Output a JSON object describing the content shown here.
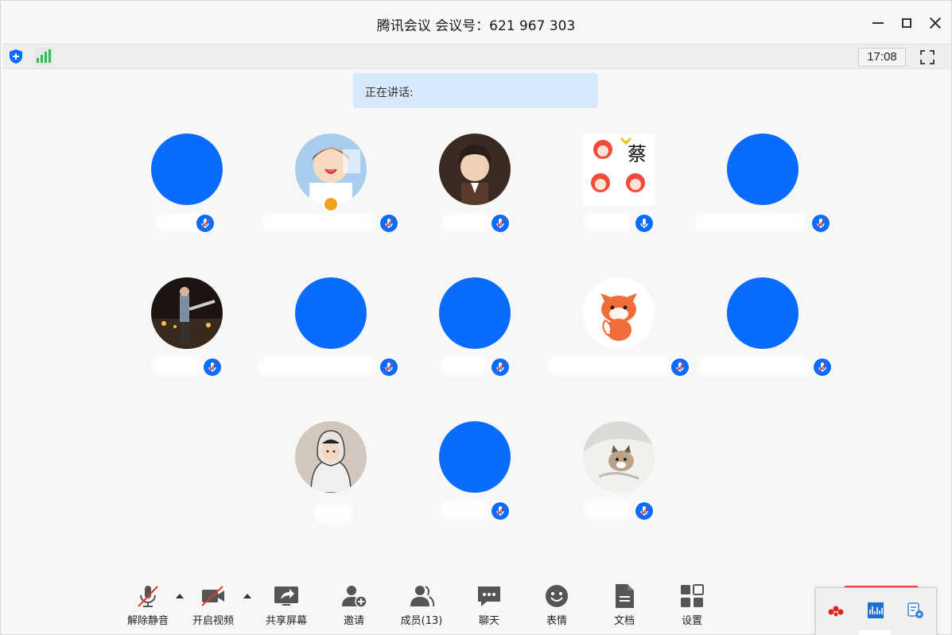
{
  "window": {
    "title": "腾讯会议 会议号：621 967 303",
    "controls": [
      "minimize",
      "maximize",
      "close"
    ]
  },
  "infobar": {
    "security_icon": "shield-icon",
    "signal_icon": "signal-strength-icon",
    "time": "17:08",
    "fullscreen_icon": "fullscreen-icon"
  },
  "speaking": {
    "label": "正在讲话:"
  },
  "participants": [
    {
      "avatar": "blue-circle",
      "mic": "muted"
    },
    {
      "avatar": "anime-girl",
      "mic": "muted",
      "host": true
    },
    {
      "avatar": "anime-boy",
      "mic": "muted"
    },
    {
      "avatar": "fox-sticker-cai",
      "mic": "unmuted",
      "avatar_text": "蔡"
    },
    {
      "avatar": "blue-circle",
      "mic": "muted"
    },
    {
      "avatar": "night-photo",
      "mic": "muted"
    },
    {
      "avatar": "blue-circle",
      "mic": "muted"
    },
    {
      "avatar": "blue-circle",
      "mic": "muted"
    },
    {
      "avatar": "fox-cartoon",
      "mic": "muted"
    },
    {
      "avatar": "blue-circle",
      "mic": "muted"
    },
    {
      "avatar": "hoodie-boy",
      "mic": "none"
    },
    {
      "avatar": "blue-circle",
      "mic": "muted"
    },
    {
      "avatar": "cat-photo",
      "mic": "muted"
    }
  ],
  "toolbar": {
    "unmute": "解除静音",
    "start_video": "开启视频",
    "share_screen": "共享屏幕",
    "invite": "邀请",
    "members": "成员(13)",
    "chat": "聊天",
    "reactions": "表情",
    "documents": "文档",
    "settings": "设置"
  },
  "tray": {
    "icons": [
      "app-tray-icon",
      "audio-tray-icon",
      "translate-tray-icon"
    ]
  },
  "colors": {
    "accent": "#0a6cff",
    "speaking_bg": "#d7e8fb",
    "host_badge": "#f2a31b",
    "signal": "#2cbf4a",
    "muted_slash": "#e33"
  }
}
